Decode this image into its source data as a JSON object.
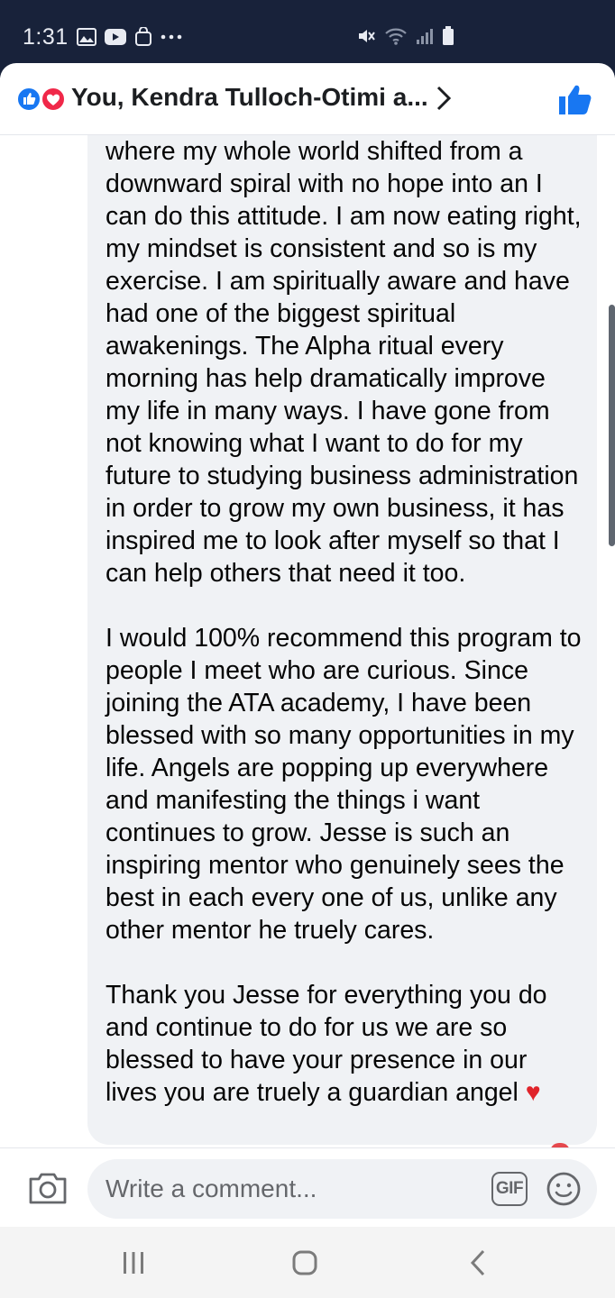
{
  "status_bar": {
    "time": "1:31",
    "left_icons": [
      "gallery-icon",
      "youtube-icon",
      "bag-icon",
      "more-dots-icon"
    ],
    "right_icons": [
      "mute-icon",
      "wifi-icon",
      "signal-icon",
      "battery-icon"
    ]
  },
  "header": {
    "title": "You, Kendra Tulloch-Otimi a...",
    "reactions": [
      "like-reaction-icon",
      "love-reaction-icon"
    ],
    "like_color": "#1877f2"
  },
  "comment": {
    "paragraphs": [
      "where my whole world shifted from a downward spiral with no hope into an I can do this attitude. I am now eating right, my mindset is consistent and so is my exercise. I am spiritually aware and have had one of the biggest spiritual awakenings. The Alpha ritual every morning has help dramatically improve my life in many ways. I have gone from not knowing what I want to do for my future to studying business administration in order to grow my own business, it has inspired me to look after myself so that I can help others that need it too.",
      "I would 100% recommend this program to people I meet who are curious. Since joining the ATA academy, I have been blessed with so many opportunities in my life. Angels are popping up everywhere and manifesting the things i want continues to grow. Jesse is such an inspiring mentor who genuinely sees the best in each every one of us, unlike any other mentor he truely cares.",
      "Thank you Jesse for everything you do and continue to do for us we are so blessed to have your presence in our lives you are truely a guardian angel"
    ],
    "end_emoji": "♥"
  },
  "composer": {
    "placeholder": "Write a comment...",
    "gif_label": "GIF"
  },
  "nav": {
    "items": [
      "recents-icon",
      "home-icon",
      "back-icon"
    ]
  }
}
